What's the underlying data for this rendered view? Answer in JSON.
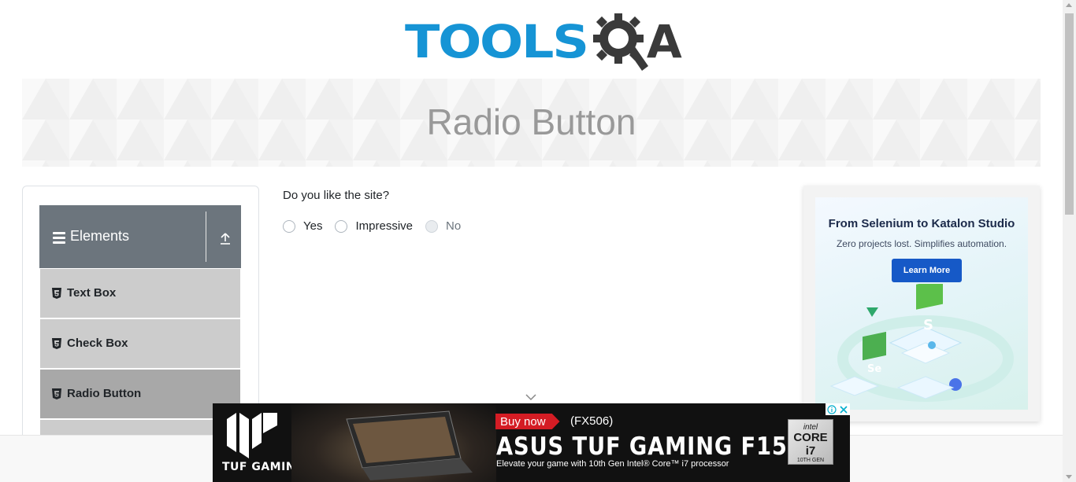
{
  "header": {
    "logo_tools": "TOOLS",
    "logo_a": "A"
  },
  "banner": {
    "title": "Radio Button"
  },
  "sidebar": {
    "group_label": "Elements",
    "items": [
      {
        "label": "Text Box",
        "active": false
      },
      {
        "label": "Check Box",
        "active": false
      },
      {
        "label": "Radio Button",
        "active": true
      }
    ]
  },
  "main": {
    "question": "Do you like the site?",
    "options": [
      {
        "label": "Yes",
        "disabled": false
      },
      {
        "label": "Impressive",
        "disabled": false
      },
      {
        "label": "No",
        "disabled": true
      }
    ]
  },
  "side_ad": {
    "headline": "From Selenium to Katalon Studio",
    "subtext": "Zero projects lost. Simplifies automation.",
    "button_label": "Learn More"
  },
  "bottom_ad": {
    "brand_label": "TUF GAMING",
    "buy_label": "Buy now",
    "model": "(FX506)",
    "headline": "ASUS TUF GAMING F15",
    "tagline": "Elevate your game with 10th Gen Intel® Core™ i7 processor",
    "badge_top": "intel",
    "badge_main": "CORE i7",
    "badge_bottom": "10TH GEN"
  },
  "colors": {
    "brand_blue": "#1694d5",
    "sidebar_header": "#6c757d",
    "menu_item": "#cccccc",
    "menu_item_active": "#a8a8a8",
    "ad_button": "#1659c7",
    "buy_red": "#d41c24"
  }
}
